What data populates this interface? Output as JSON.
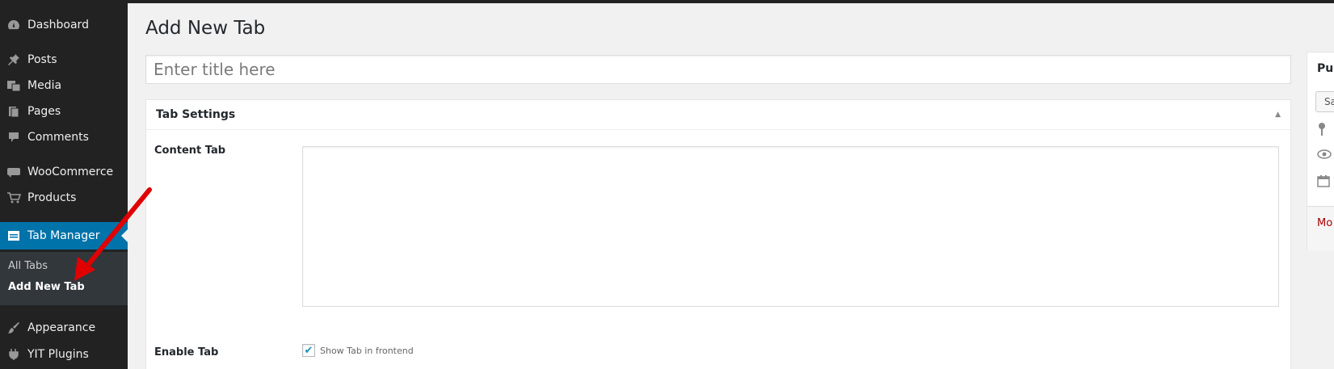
{
  "sidebar": {
    "items": [
      {
        "label": "Dashboard",
        "icon": "dashboard-icon"
      },
      {
        "label": "Posts",
        "icon": "pin-icon"
      },
      {
        "label": "Media",
        "icon": "media-icon"
      },
      {
        "label": "Pages",
        "icon": "pages-icon"
      },
      {
        "label": "Comments",
        "icon": "comment-icon"
      },
      {
        "label": "WooCommerce",
        "icon": "woocommerce-icon"
      },
      {
        "label": "Products",
        "icon": "cart-icon"
      },
      {
        "label": "Tab Manager",
        "icon": "tab-manager-icon"
      },
      {
        "label": "Appearance",
        "icon": "brush-icon"
      },
      {
        "label": "YIT Plugins",
        "icon": "plugin-icon"
      }
    ],
    "submenu": [
      {
        "label": "All Tabs"
      },
      {
        "label": "Add New Tab"
      }
    ],
    "active_color": "#0073aa"
  },
  "main": {
    "page_title": "Add New Tab",
    "title_placeholder": "Enter title here",
    "postbox": {
      "title": "Tab Settings",
      "content_label": "Content Tab",
      "enable_label": "Enable Tab",
      "checkbox_label": "Show Tab in frontend",
      "checkbox_checked": true
    }
  },
  "publish": {
    "title": "Pul",
    "save_label": "Sa",
    "move_link": "Mo"
  },
  "annotation": {
    "arrow_color": "#e00000"
  }
}
